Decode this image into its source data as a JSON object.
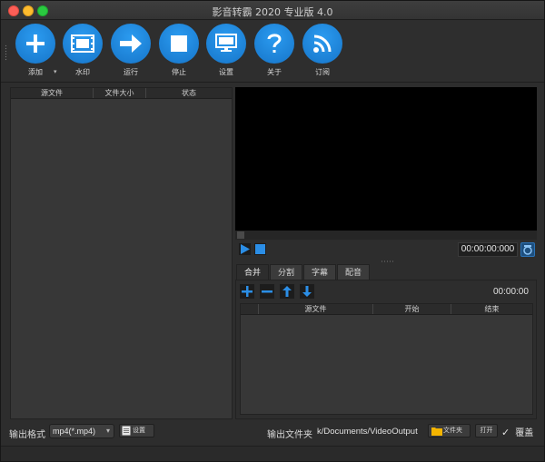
{
  "window": {
    "title": "影音转霸 2020 专业版 4.0"
  },
  "toolbar": {
    "buttons": [
      {
        "label": "添加",
        "icon": "plus-icon"
      },
      {
        "label": "水印",
        "icon": "film-icon"
      },
      {
        "label": "运行",
        "icon": "arrow-right-icon"
      },
      {
        "label": "停止",
        "icon": "stop-icon"
      },
      {
        "label": "设置",
        "icon": "monitor-icon"
      },
      {
        "label": "关于",
        "icon": "question-icon"
      },
      {
        "label": "订阅",
        "icon": "rss-icon"
      }
    ]
  },
  "file_list": {
    "columns": [
      "源文件",
      "文件大小",
      "状态"
    ]
  },
  "player": {
    "timecode": "00:00:00:000"
  },
  "tabs": [
    "合并",
    "分割",
    "字幕",
    "配音"
  ],
  "merge": {
    "time": "00:00:00",
    "columns": [
      "源文件",
      "开始",
      "结束"
    ]
  },
  "bottom": {
    "format_label": "输出格式",
    "format_value": "mp4(*.mp4)",
    "format_settings": "设置",
    "folder_label": "输出文件夹",
    "folder_path": "k/Documents/VideoOutput",
    "folder_button": "文件夹",
    "open_button": "打开",
    "overwrite_label": "覆盖",
    "overwrite_checked": true
  },
  "colors": {
    "accent": "#1a86de",
    "window_bg": "#2d2d2d",
    "panel_bg": "#373737"
  }
}
